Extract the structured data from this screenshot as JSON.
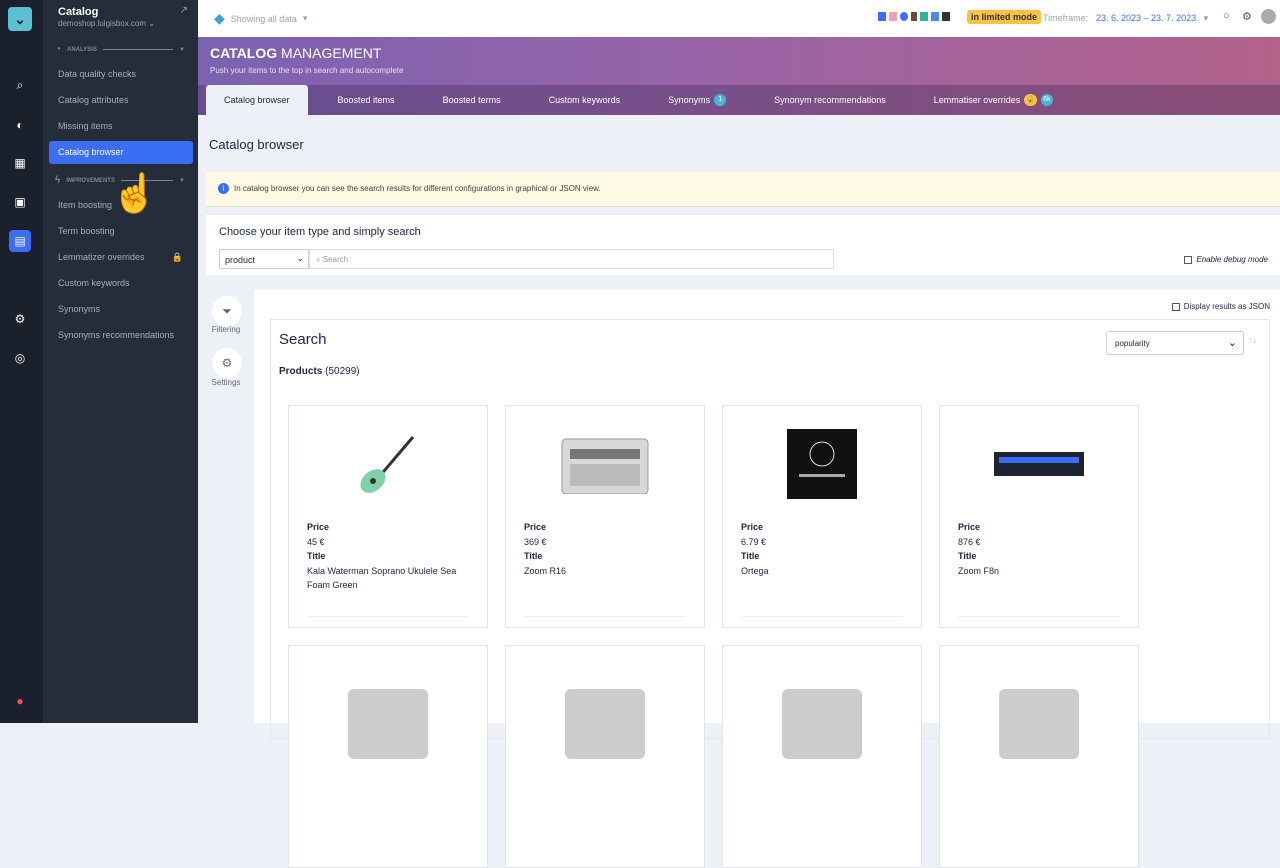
{
  "sidebar": {
    "title": "Catalog",
    "domain": "demoshop.luigisbox.com",
    "analysis": "ANALYSIS",
    "improvements": "IMPROVEMENTS",
    "analysis_items": [
      "Data quality checks",
      "Catalog attributes",
      "Missing items",
      "Catalog browser"
    ],
    "improvement_items": [
      "Item boosting",
      "Term boosting",
      "Lemmatizer overrides",
      "Custom keywords",
      "Synonyms",
      "Synonyms recommendations"
    ]
  },
  "topbar": {
    "scope": "Showing all data",
    "mode": "in limited mode",
    "timeframe_label": "Timeframe:",
    "timeframe": "23. 6. 2023 – 23. 7. 2023"
  },
  "header": {
    "title_bold": "CATALOG",
    "title_rest": " MANAGEMENT",
    "subtitle": "Push your items to the top in search and autocomplete"
  },
  "tabs": [
    {
      "label": "Catalog browser"
    },
    {
      "label": "Boosted items"
    },
    {
      "label": "Boosted terms"
    },
    {
      "label": "Custom keywords"
    },
    {
      "label": "Synonyms",
      "badge": "1"
    },
    {
      "label": "Synonym recommendations"
    },
    {
      "label": "Lemmatiser overrides",
      "badge": "6k"
    }
  ],
  "page": {
    "title": "Catalog browser",
    "info": "In catalog browser you can see the search results for different configurations in graphical or JSON view.",
    "choose": "Choose your item type and simply search",
    "item_type": "product",
    "search_placeholder": "Search",
    "debug": "Enable debug mode",
    "json": "Display results as JSON",
    "filtering": "Filtering",
    "settings": "Settings",
    "search_title": "Search",
    "products_label": "Products",
    "products_count": "(50299)",
    "sort": "popularity"
  },
  "products": [
    {
      "price_label": "Price",
      "price": "45 €",
      "title_label": "Title",
      "title": "Kala Waterman Soprano Ukulele Sea Foam Green"
    },
    {
      "price_label": "Price",
      "price": "369 €",
      "title_label": "Title",
      "title": "Zoom R16"
    },
    {
      "price_label": "Price",
      "price": "6.79 €",
      "title_label": "Title",
      "title": "Ortega"
    },
    {
      "price_label": "Price",
      "price": "876 €",
      "title_label": "Title",
      "title": "Zoom F8n"
    }
  ]
}
